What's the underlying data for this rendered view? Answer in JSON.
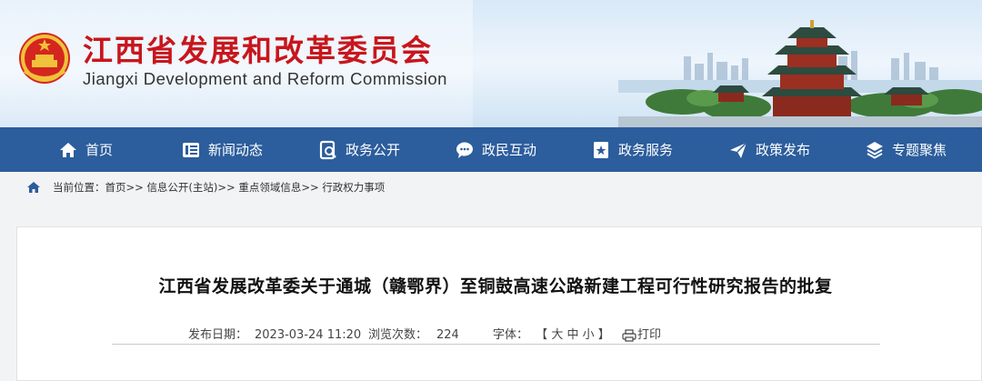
{
  "header": {
    "title": "江西省发展和改革委员会",
    "subtitle": "Jiangxi Development and Reform Commission"
  },
  "nav": {
    "items": [
      {
        "label": "首页",
        "icon": "home-icon"
      },
      {
        "label": "新闻动态",
        "icon": "news-icon"
      },
      {
        "label": "政务公开",
        "icon": "document-icon"
      },
      {
        "label": "政民互动",
        "icon": "chat-icon"
      },
      {
        "label": "政务服务",
        "icon": "service-icon"
      },
      {
        "label": "政策发布",
        "icon": "send-icon"
      },
      {
        "label": "专题聚焦",
        "icon": "layers-icon"
      }
    ]
  },
  "breadcrumb": {
    "prefix": "当前位置：",
    "items": [
      "首页",
      "信息公开(主站)",
      "重点领域信息",
      "行政权力事项"
    ],
    "separator": ">>"
  },
  "article": {
    "title": "江西省发展改革委关于通城（赣鄂界）至铜鼓高速公路新建工程可行性研究报告的批复",
    "publish_label": "发布日期：",
    "publish_date": "2023-03-24 11:20",
    "views_label": "浏览次数：",
    "views": "224",
    "font_label": "字体：",
    "font_open": "【",
    "font_large": "大",
    "font_medium": "中",
    "font_small": "小",
    "font_close": "】",
    "print_label": "打印"
  },
  "colors": {
    "brand_red": "#c8161d",
    "nav_blue": "#2c5d9c"
  }
}
